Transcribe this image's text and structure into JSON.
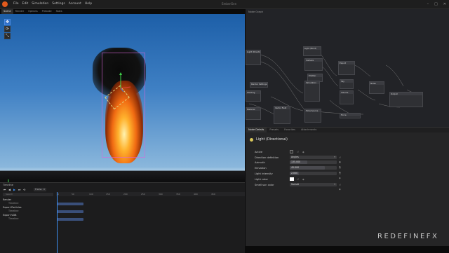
{
  "menubar": {
    "items": [
      "File",
      "Edit",
      "Simulation",
      "Settings",
      "Account",
      "Help"
    ],
    "app_title": "EmberGen",
    "window_controls": [
      "–",
      "□",
      "✕"
    ]
  },
  "viewport": {
    "tabs": [
      "Scene",
      "Render",
      "Options",
      "Prebake",
      "Stats"
    ],
    "active_tab": "Scene",
    "tools": [
      "move-tool",
      "rotate-tool",
      "scale-tool"
    ]
  },
  "node_graph": {
    "title": "Node Graph",
    "nodes": [
      {
        "label": "Light (Directional)"
      },
      {
        "label": "Light (Point)"
      },
      {
        "label": "Camera"
      },
      {
        "label": "Emitter"
      },
      {
        "label": "Simulation"
      },
      {
        "label": "Render Settings"
      },
      {
        "label": "Shading"
      },
      {
        "label": "Material"
      },
      {
        "label": "Vector Field"
      },
      {
        "label": "Time Source"
      },
      {
        "label": "Export"
      },
      {
        "label": "Sky"
      },
      {
        "label": "Volume"
      },
      {
        "label": "Force"
      },
      {
        "label": "Noise"
      },
      {
        "label": "Output"
      }
    ]
  },
  "properties": {
    "tabs": [
      "Node Details",
      "Presets",
      "Favorites",
      "Attachments"
    ],
    "active_tab": "Node Details",
    "title": "Light (Directional)",
    "rows": [
      {
        "label": "Active",
        "type": "checkbox",
        "value": true
      },
      {
        "label": "Direction definition",
        "type": "dropdown",
        "value": "Angles"
      },
      {
        "label": "Azimuth",
        "type": "slider",
        "value": "135.000",
        "fraction": 0.38
      },
      {
        "label": "Elevation",
        "type": "slider",
        "value": "45.000",
        "fraction": 0.75
      },
      {
        "label": "Light intensity",
        "type": "slider",
        "value": "2.000",
        "fraction": 0.2
      },
      {
        "label": "Light color",
        "type": "color",
        "value": "#ffffff"
      },
      {
        "label": "Smell sun color",
        "type": "dropdown",
        "value": "Sunset"
      }
    ]
  },
  "timeline": {
    "title": "Timeline",
    "transport": [
      "⏮",
      "◀",
      "▶",
      "⏭",
      "⟲"
    ],
    "frame_label": "Frame",
    "frame_value": "0",
    "search_placeholder": "Search",
    "ruler_ticks": [
      "0",
      "50",
      "100",
      "150",
      "200",
      "250",
      "300",
      "350",
      "400",
      "450"
    ],
    "rows": [
      {
        "label": "Render",
        "sub": "Timeline",
        "kind": "parent"
      },
      {
        "label": "Export Particles",
        "sub": "Timeline",
        "kind": "parent"
      },
      {
        "label": "Export VDB",
        "sub": "Timeline",
        "kind": "parent"
      }
    ],
    "clip_fraction": 0.14
  },
  "brand": {
    "text": "REDEFINEFX"
  },
  "colors": {
    "accent": "#3d8ef0",
    "logo": "#e25a1c",
    "fire_core": "#ffb22d"
  }
}
